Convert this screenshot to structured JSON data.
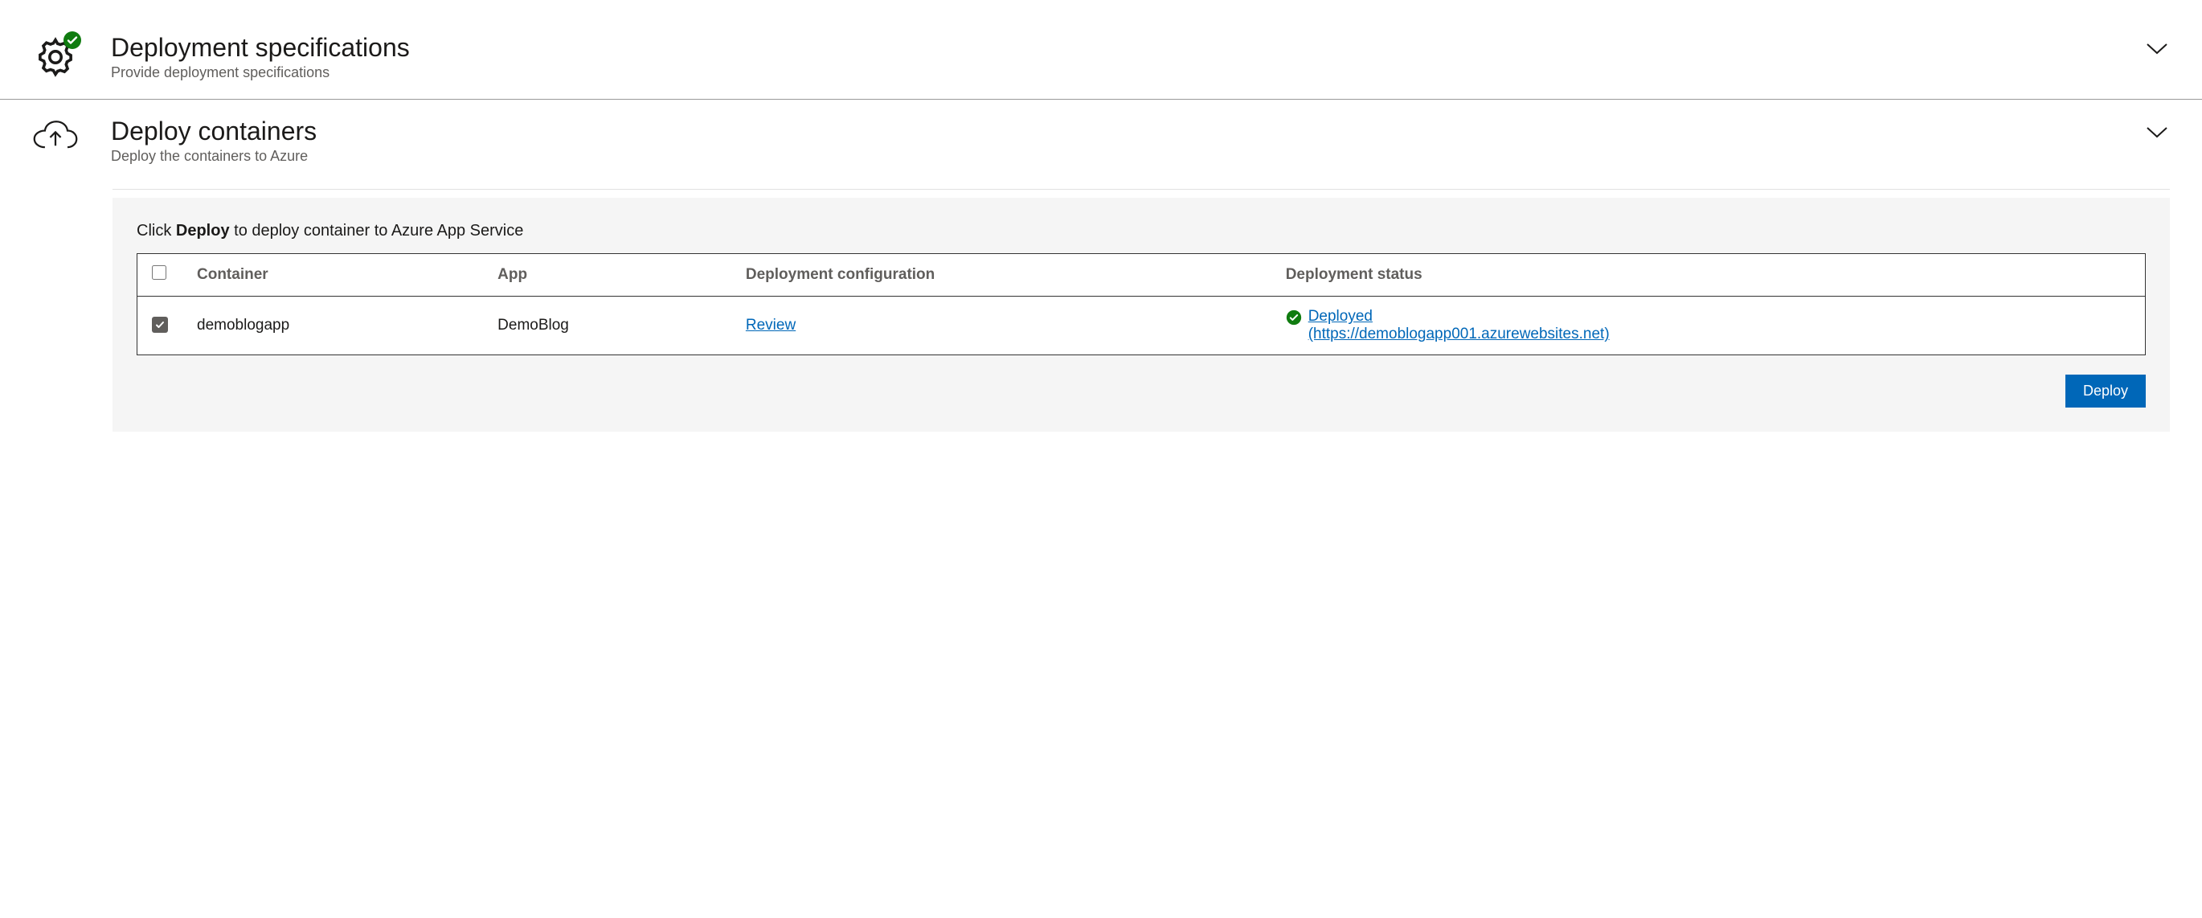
{
  "specs": {
    "title": "Deployment specifications",
    "subtitle": "Provide deployment specifications"
  },
  "deploy": {
    "title": "Deploy containers",
    "subtitle": "Deploy the containers to Azure",
    "instruction_prefix": "Click ",
    "instruction_strong": "Deploy",
    "instruction_suffix": " to deploy container to Azure App Service",
    "columns": {
      "container": "Container",
      "app": "App",
      "config": "Deployment configuration",
      "status": "Deployment status"
    },
    "rows": [
      {
        "checked": true,
        "container": "demoblogapp",
        "app": "DemoBlog",
        "config_link": "Review",
        "status_label": "Deployed",
        "status_url_text": "(https://demoblogapp001.azurewebsites.net)"
      }
    ],
    "deploy_button": "Deploy"
  }
}
